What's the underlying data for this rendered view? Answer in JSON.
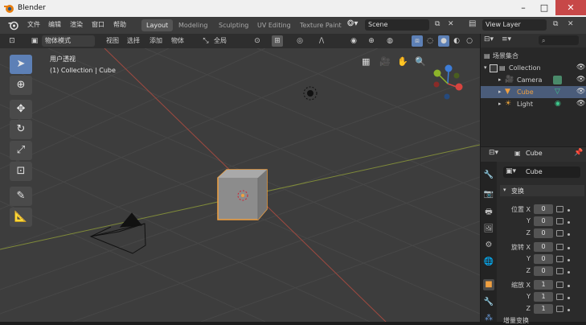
{
  "window": {
    "title": "Blender",
    "controls": [
      "–",
      "□",
      "✕"
    ]
  },
  "menu": [
    "文件",
    "编辑",
    "渲染",
    "窗口",
    "帮助"
  ],
  "workspaces": [
    "Layout",
    "Modeling",
    "Sculpting",
    "UV Editing",
    "Texture Paint"
  ],
  "scene": {
    "name": "Scene",
    "view_layer": "View Layer"
  },
  "header": {
    "mode": "物体模式",
    "menus": [
      "视图",
      "选择",
      "添加",
      "物体"
    ],
    "orientation": "全局"
  },
  "viewport": {
    "view_name": "用户透视",
    "collection_info": "(1) Collection | Cube"
  },
  "outliner": {
    "root": "场景集合",
    "items": [
      {
        "label": "Collection",
        "color": "#cfcfcf"
      },
      {
        "label": "Camera",
        "color": "#cfcfcf"
      },
      {
        "label": "Cube",
        "color": "#f0a040"
      },
      {
        "label": "Light",
        "color": "#cfcfcf"
      }
    ]
  },
  "properties": {
    "object_name": "Cube",
    "panel": "变换",
    "groups": [
      {
        "label": "位置",
        "axes": [
          {
            "axis": "X",
            "value": "0"
          },
          {
            "axis": "Y",
            "value": "0"
          },
          {
            "axis": "Z",
            "value": "0"
          }
        ]
      },
      {
        "label": "旋转",
        "axes": [
          {
            "axis": "X",
            "value": "0"
          },
          {
            "axis": "Y",
            "value": "0"
          },
          {
            "axis": "Z",
            "value": "0"
          }
        ]
      },
      {
        "label": "缩放",
        "axes": [
          {
            "axis": "X",
            "value": "1"
          },
          {
            "axis": "Y",
            "value": "1"
          },
          {
            "axis": "Z",
            "value": "1"
          }
        ]
      }
    ],
    "next_panel": "增量变换"
  },
  "colors": {
    "accent": "#5d80b6",
    "selection": "#f0a040",
    "x_axis": "#d8443f",
    "y_axis": "#8db42a",
    "z_axis": "#3d7dd8"
  }
}
